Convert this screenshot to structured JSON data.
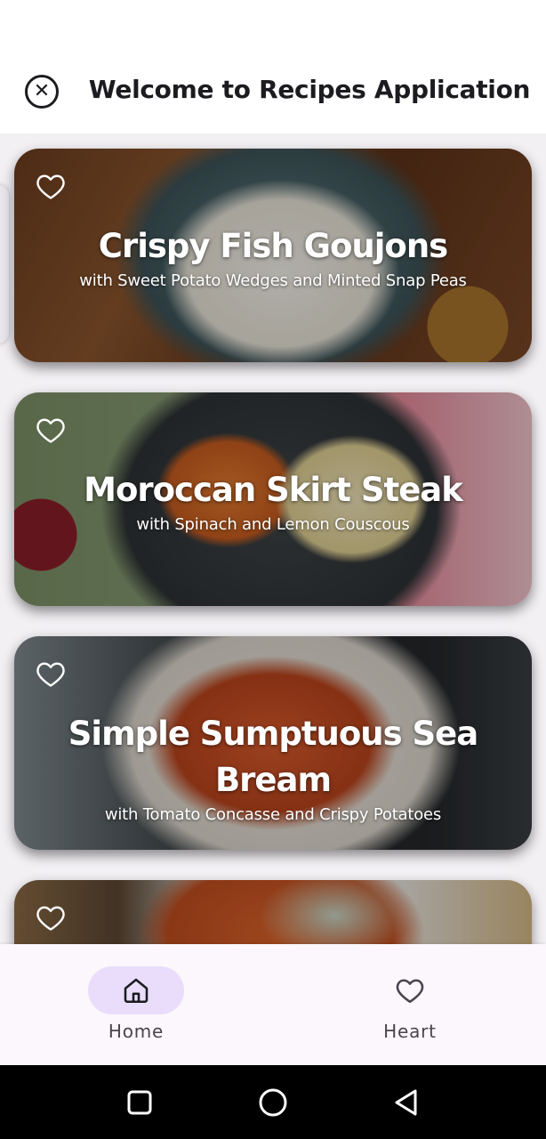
{
  "app_bar": {
    "close_icon": "close-circle-icon",
    "title": "Welcome to Recipes Application"
  },
  "recipes": [
    {
      "title": "Crispy Fish Goujons",
      "subtitle": "with Sweet Potato Wedges and Minted Snap Peas",
      "favorite_icon": "heart-outline-icon"
    },
    {
      "title": "Moroccan Skirt Steak",
      "subtitle": "with Spinach and Lemon Couscous",
      "favorite_icon": "heart-outline-icon"
    },
    {
      "title": "Simple Sumptuous Sea Bream",
      "subtitle": "with Tomato Concasse and Crispy Potatoes",
      "favorite_icon": "heart-outline-icon"
    },
    {
      "title": "",
      "subtitle": "",
      "favorite_icon": "heart-outline-icon"
    }
  ],
  "bottom_nav": {
    "items": [
      {
        "label": "Home",
        "icon": "home-icon",
        "selected": true
      },
      {
        "label": "Heart",
        "icon": "heart-outline-icon",
        "selected": false
      }
    ]
  },
  "system_nav": {
    "buttons": [
      "recents-square-icon",
      "home-circle-icon",
      "back-triangle-icon"
    ]
  },
  "colors": {
    "nav_indicator": "#e9ddfb",
    "nav_label": "#49454f",
    "title_text": "#1c1b1f"
  }
}
